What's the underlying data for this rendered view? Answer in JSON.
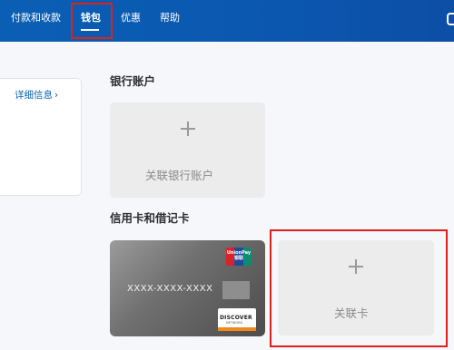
{
  "nav": {
    "items": [
      {
        "label": "付款和收款"
      },
      {
        "label": "钱包"
      },
      {
        "label": "优惠"
      },
      {
        "label": "帮助"
      }
    ],
    "active": "钱包"
  },
  "left_panel": {
    "details_label": "详细信息",
    "chevron": "›"
  },
  "bank_section": {
    "title": "银行账户",
    "add_label": "关联银行账户"
  },
  "card_section": {
    "title": "信用卡和借记卡",
    "card": {
      "number_masked": "XXXX-XXXX-XXXX",
      "unionpay_text": "UnionPay 银联",
      "discover_text": "DISCOVER",
      "discover_sub": "NETWORK"
    },
    "add_label": "关联卡"
  },
  "colors": {
    "nav_bg": "#0b57b0",
    "highlight": "#e0201a",
    "link": "#0a5fb4"
  }
}
